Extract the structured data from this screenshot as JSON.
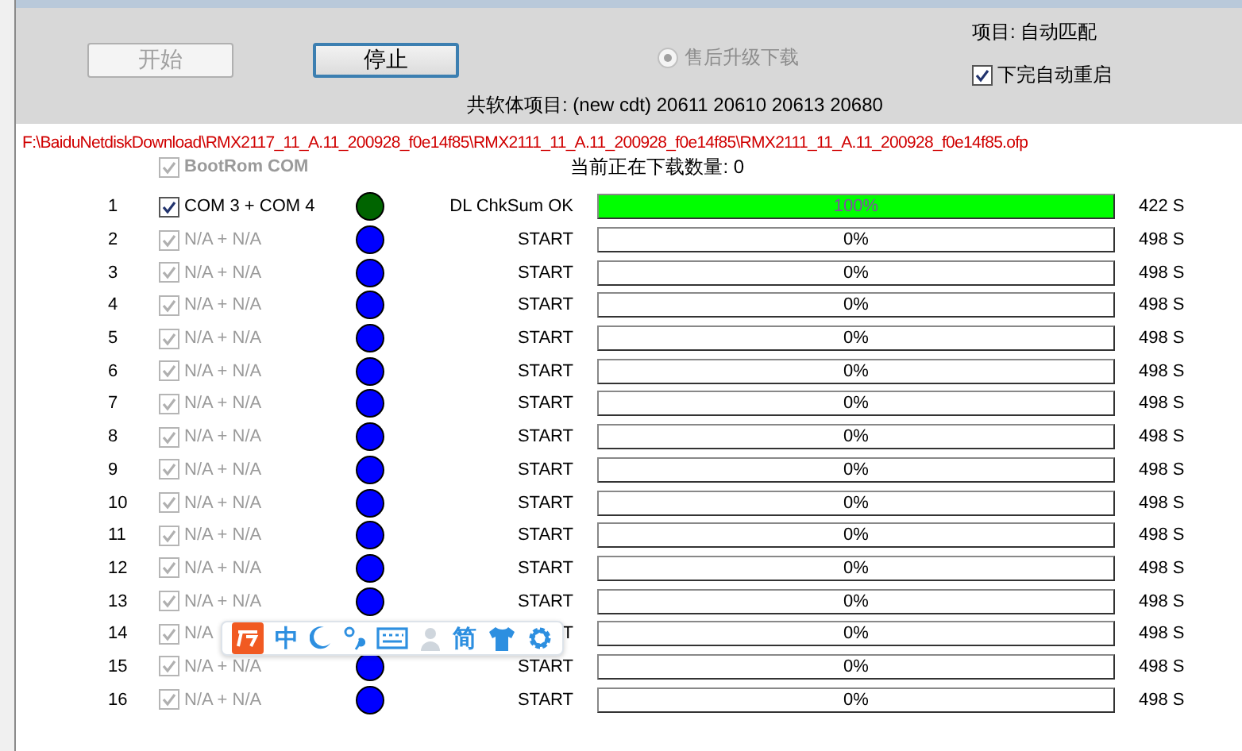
{
  "toolbar": {
    "start_button": {
      "label": "开始",
      "disabled": true
    },
    "stop_button": {
      "label": "停止",
      "disabled": false
    },
    "radio": {
      "label": "售后升级下载",
      "selected": true,
      "disabled": true
    },
    "project": "项目:  自动匹配",
    "auto_reboot": {
      "label": "下完自动重启",
      "checked": true
    },
    "shared_projects": "共软体项目: (new cdt)  20611 20610 20613 20680"
  },
  "path": "F:\\BaiduNetdiskDownload\\RMX2117_11_A.11_200928_f0e14f85\\RMX2111_11_A.11_200928_f0e14f85\\RMX2111_11_A.11_200928_f0e14f85.ofp",
  "bootrom": {
    "label": "BootRom COM",
    "checked": true,
    "disabled": true
  },
  "download_count": "当前正在下载数量:  0",
  "ports": [
    {
      "number": "1",
      "com": "COM  3 + COM  4",
      "checked": true,
      "disabled": false,
      "color": "#006400",
      "status": "DL ChkSum OK",
      "level": 1,
      "percent": "100%",
      "time": "422 S"
    },
    {
      "number": "2",
      "com": "N/A + N/A",
      "checked": true,
      "disabled": true,
      "color": "#0000ff",
      "status": "START",
      "level": 0,
      "percent": "0%",
      "time": "498 S"
    },
    {
      "number": "3",
      "com": "N/A + N/A",
      "checked": true,
      "disabled": true,
      "color": "#0000ff",
      "status": "START",
      "level": 0,
      "percent": "0%",
      "time": "498 S"
    },
    {
      "number": "4",
      "com": "N/A + N/A",
      "checked": true,
      "disabled": true,
      "color": "#0000ff",
      "status": "START",
      "level": 0,
      "percent": "0%",
      "time": "498 S"
    },
    {
      "number": "5",
      "com": "N/A + N/A",
      "checked": true,
      "disabled": true,
      "color": "#0000ff",
      "status": "START",
      "level": 0,
      "percent": "0%",
      "time": "498 S"
    },
    {
      "number": "6",
      "com": "N/A + N/A",
      "checked": true,
      "disabled": true,
      "color": "#0000ff",
      "status": "START",
      "level": 0,
      "percent": "0%",
      "time": "498 S"
    },
    {
      "number": "7",
      "com": "N/A + N/A",
      "checked": true,
      "disabled": true,
      "color": "#0000ff",
      "status": "START",
      "level": 0,
      "percent": "0%",
      "time": "498 S"
    },
    {
      "number": "8",
      "com": "N/A + N/A",
      "checked": true,
      "disabled": true,
      "color": "#0000ff",
      "status": "START",
      "level": 0,
      "percent": "0%",
      "time": "498 S"
    },
    {
      "number": "9",
      "com": "N/A + N/A",
      "checked": true,
      "disabled": true,
      "color": "#0000ff",
      "status": "START",
      "level": 0,
      "percent": "0%",
      "time": "498 S"
    },
    {
      "number": "10",
      "com": "N/A + N/A",
      "checked": true,
      "disabled": true,
      "color": "#0000ff",
      "status": "START",
      "level": 0,
      "percent": "0%",
      "time": "498 S"
    },
    {
      "number": "11",
      "com": "N/A + N/A",
      "checked": true,
      "disabled": true,
      "color": "#0000ff",
      "status": "START",
      "level": 0,
      "percent": "0%",
      "time": "498 S"
    },
    {
      "number": "12",
      "com": "N/A + N/A",
      "checked": true,
      "disabled": true,
      "color": "#0000ff",
      "status": "START",
      "level": 0,
      "percent": "0%",
      "time": "498 S"
    },
    {
      "number": "13",
      "com": "N/A + N/A",
      "checked": true,
      "disabled": true,
      "color": "#0000ff",
      "status": "START",
      "level": 0,
      "percent": "0%",
      "time": "498 S"
    },
    {
      "number": "14",
      "com": "N/A",
      "checked": true,
      "disabled": true,
      "status": "T",
      "level": 0,
      "percent": "0%",
      "time": "498 S"
    },
    {
      "number": "15",
      "com": "N/A + N/A",
      "checked": true,
      "disabled": true,
      "color": "#0000ff",
      "status": "START",
      "level": 0,
      "percent": "0%",
      "time": "498 S"
    },
    {
      "number": "16",
      "com": "N/A + N/A",
      "checked": true,
      "disabled": true,
      "color": "#0000ff",
      "status": "START",
      "level": 0,
      "percent": "0%",
      "time": "498 S"
    }
  ],
  "ime_toolbar": {
    "mode": "中",
    "script": "简"
  }
}
